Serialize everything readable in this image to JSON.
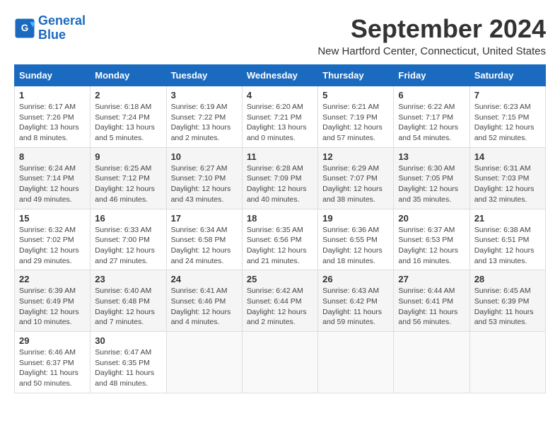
{
  "logo": {
    "line1": "General",
    "line2": "Blue"
  },
  "title": "September 2024",
  "location": "New Hartford Center, Connecticut, United States",
  "days_of_week": [
    "Sunday",
    "Monday",
    "Tuesday",
    "Wednesday",
    "Thursday",
    "Friday",
    "Saturday"
  ],
  "weeks": [
    [
      {
        "day": "1",
        "info": "Sunrise: 6:17 AM\nSunset: 7:26 PM\nDaylight: 13 hours\nand 8 minutes."
      },
      {
        "day": "2",
        "info": "Sunrise: 6:18 AM\nSunset: 7:24 PM\nDaylight: 13 hours\nand 5 minutes."
      },
      {
        "day": "3",
        "info": "Sunrise: 6:19 AM\nSunset: 7:22 PM\nDaylight: 13 hours\nand 2 minutes."
      },
      {
        "day": "4",
        "info": "Sunrise: 6:20 AM\nSunset: 7:21 PM\nDaylight: 13 hours\nand 0 minutes."
      },
      {
        "day": "5",
        "info": "Sunrise: 6:21 AM\nSunset: 7:19 PM\nDaylight: 12 hours\nand 57 minutes."
      },
      {
        "day": "6",
        "info": "Sunrise: 6:22 AM\nSunset: 7:17 PM\nDaylight: 12 hours\nand 54 minutes."
      },
      {
        "day": "7",
        "info": "Sunrise: 6:23 AM\nSunset: 7:15 PM\nDaylight: 12 hours\nand 52 minutes."
      }
    ],
    [
      {
        "day": "8",
        "info": "Sunrise: 6:24 AM\nSunset: 7:14 PM\nDaylight: 12 hours\nand 49 minutes."
      },
      {
        "day": "9",
        "info": "Sunrise: 6:25 AM\nSunset: 7:12 PM\nDaylight: 12 hours\nand 46 minutes."
      },
      {
        "day": "10",
        "info": "Sunrise: 6:27 AM\nSunset: 7:10 PM\nDaylight: 12 hours\nand 43 minutes."
      },
      {
        "day": "11",
        "info": "Sunrise: 6:28 AM\nSunset: 7:09 PM\nDaylight: 12 hours\nand 40 minutes."
      },
      {
        "day": "12",
        "info": "Sunrise: 6:29 AM\nSunset: 7:07 PM\nDaylight: 12 hours\nand 38 minutes."
      },
      {
        "day": "13",
        "info": "Sunrise: 6:30 AM\nSunset: 7:05 PM\nDaylight: 12 hours\nand 35 minutes."
      },
      {
        "day": "14",
        "info": "Sunrise: 6:31 AM\nSunset: 7:03 PM\nDaylight: 12 hours\nand 32 minutes."
      }
    ],
    [
      {
        "day": "15",
        "info": "Sunrise: 6:32 AM\nSunset: 7:02 PM\nDaylight: 12 hours\nand 29 minutes."
      },
      {
        "day": "16",
        "info": "Sunrise: 6:33 AM\nSunset: 7:00 PM\nDaylight: 12 hours\nand 27 minutes."
      },
      {
        "day": "17",
        "info": "Sunrise: 6:34 AM\nSunset: 6:58 PM\nDaylight: 12 hours\nand 24 minutes."
      },
      {
        "day": "18",
        "info": "Sunrise: 6:35 AM\nSunset: 6:56 PM\nDaylight: 12 hours\nand 21 minutes."
      },
      {
        "day": "19",
        "info": "Sunrise: 6:36 AM\nSunset: 6:55 PM\nDaylight: 12 hours\nand 18 minutes."
      },
      {
        "day": "20",
        "info": "Sunrise: 6:37 AM\nSunset: 6:53 PM\nDaylight: 12 hours\nand 16 minutes."
      },
      {
        "day": "21",
        "info": "Sunrise: 6:38 AM\nSunset: 6:51 PM\nDaylight: 12 hours\nand 13 minutes."
      }
    ],
    [
      {
        "day": "22",
        "info": "Sunrise: 6:39 AM\nSunset: 6:49 PM\nDaylight: 12 hours\nand 10 minutes."
      },
      {
        "day": "23",
        "info": "Sunrise: 6:40 AM\nSunset: 6:48 PM\nDaylight: 12 hours\nand 7 minutes."
      },
      {
        "day": "24",
        "info": "Sunrise: 6:41 AM\nSunset: 6:46 PM\nDaylight: 12 hours\nand 4 minutes."
      },
      {
        "day": "25",
        "info": "Sunrise: 6:42 AM\nSunset: 6:44 PM\nDaylight: 12 hours\nand 2 minutes."
      },
      {
        "day": "26",
        "info": "Sunrise: 6:43 AM\nSunset: 6:42 PM\nDaylight: 11 hours\nand 59 minutes."
      },
      {
        "day": "27",
        "info": "Sunrise: 6:44 AM\nSunset: 6:41 PM\nDaylight: 11 hours\nand 56 minutes."
      },
      {
        "day": "28",
        "info": "Sunrise: 6:45 AM\nSunset: 6:39 PM\nDaylight: 11 hours\nand 53 minutes."
      }
    ],
    [
      {
        "day": "29",
        "info": "Sunrise: 6:46 AM\nSunset: 6:37 PM\nDaylight: 11 hours\nand 50 minutes."
      },
      {
        "day": "30",
        "info": "Sunrise: 6:47 AM\nSunset: 6:35 PM\nDaylight: 11 hours\nand 48 minutes."
      },
      null,
      null,
      null,
      null,
      null
    ]
  ]
}
